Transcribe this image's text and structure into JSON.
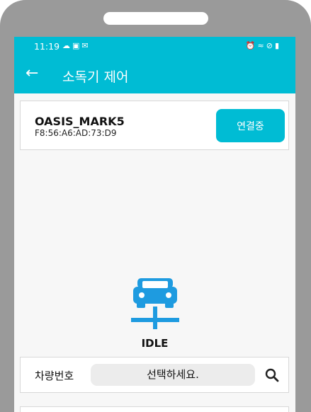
{
  "status_bar": {
    "time": "11:19",
    "left_icons": [
      "weather-icon",
      "calendar-icon",
      "mail-icon"
    ],
    "right_icons": [
      "alarm-icon",
      "wifi-icon",
      "dnd-icon",
      "battery-icon"
    ]
  },
  "app_bar": {
    "title": "소독기 제어"
  },
  "device": {
    "name": "OASIS_MARK5",
    "mac": "F8:56:A6:AD:73:D9",
    "connect_label": "연결중"
  },
  "status": {
    "icon": "car-lift-icon",
    "label": "IDLE"
  },
  "vehicle": {
    "label": "차량번호",
    "select_value": "선택하세요."
  },
  "colors": {
    "accent": "#00bcd4",
    "icon_blue": "#1e9be0"
  }
}
